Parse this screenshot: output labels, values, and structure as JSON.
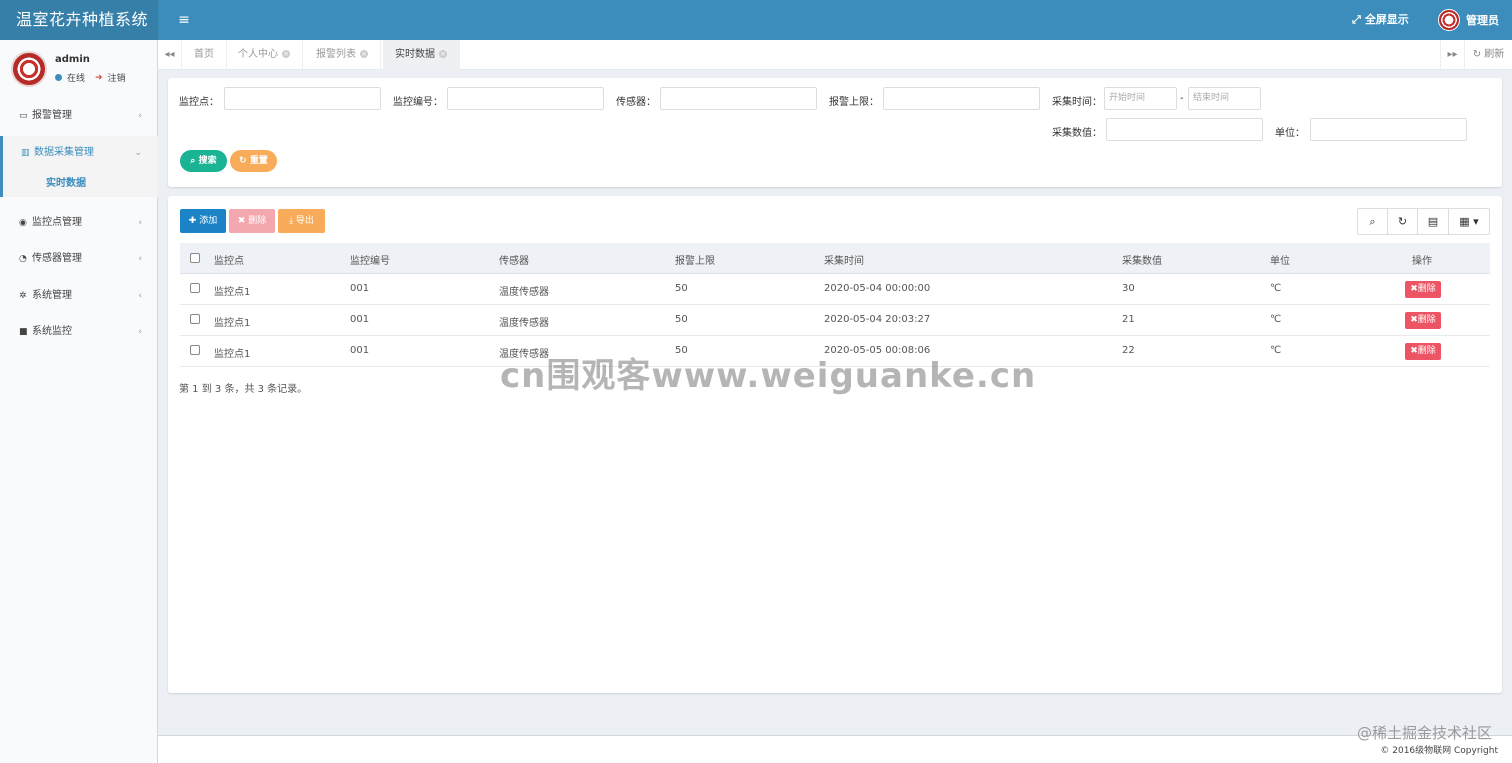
{
  "header": {
    "brand": "温室花卉种植系统",
    "menu_icon": "≡",
    "fullscreen_label": "全屏显示",
    "user_label": "管理员"
  },
  "sidebar": {
    "username": "admin",
    "status": "在线",
    "logout": "注销",
    "items": [
      {
        "label": "报警管理",
        "icon": "monitor-icon"
      },
      {
        "label": "数据采集管理",
        "icon": "bar-chart-icon"
      },
      {
        "label": "监控点管理",
        "icon": "eye-icon"
      },
      {
        "label": "传感器管理",
        "icon": "gauge-icon"
      },
      {
        "label": "系统管理",
        "icon": "gear-icon"
      },
      {
        "label": "系统监控",
        "icon": "video-icon"
      }
    ],
    "sub_item": "实时数据"
  },
  "tabs": {
    "items": [
      "首页",
      "个人中心",
      "报警列表",
      "实时数据"
    ],
    "refresh": "刷新"
  },
  "search": {
    "label_point": "监控点：",
    "label_code": "监控编号：",
    "label_sensor": "传感器：",
    "label_limit": "报警上限：",
    "label_time": "采集时间：",
    "start_placeholder": "开始时间",
    "end_placeholder": "结束时间",
    "dash": "-",
    "label_value": "采集数值：",
    "label_unit": "单位：",
    "search_btn": "搜索",
    "reset_btn": "重置"
  },
  "toolbar": {
    "add": "添加",
    "delete": "删除",
    "export": "导出"
  },
  "table": {
    "columns": [
      "监控点",
      "监控编号",
      "传感器",
      "报警上限",
      "采集时间",
      "采集数值",
      "单位",
      "操作"
    ],
    "rows": [
      {
        "point": "监控点1",
        "code": "001",
        "sensor": "温度传感器",
        "limit": "50",
        "time": "2020-05-04 00:00:00",
        "value": "30",
        "unit": "℃",
        "action": "删除"
      },
      {
        "point": "监控点1",
        "code": "001",
        "sensor": "温度传感器",
        "limit": "50",
        "time": "2020-05-04 20:03:27",
        "value": "21",
        "unit": "℃",
        "action": "删除"
      },
      {
        "point": "监控点1",
        "code": "001",
        "sensor": "温度传感器",
        "limit": "50",
        "time": "2020-05-05 00:08:06",
        "value": "22",
        "unit": "℃",
        "action": "删除"
      }
    ],
    "pagination": "第 1 到 3 条，共 3 条记录。"
  },
  "watermark": "cn围观客www.weiguanke.cn",
  "footer": {
    "logo_text": "@稀土掘金技术社区",
    "copyright": "© 2016级物联网 Copyright"
  },
  "colors": {
    "header": "#3c8dbc",
    "brand": "#367fa9",
    "search_btn": "#1ab394",
    "reset_btn": "#f8ac59",
    "add_btn": "#1c84c6",
    "delete_btn": "#f3a7ae",
    "export_btn": "#f8ac59",
    "row_delete": "#ed5565"
  }
}
